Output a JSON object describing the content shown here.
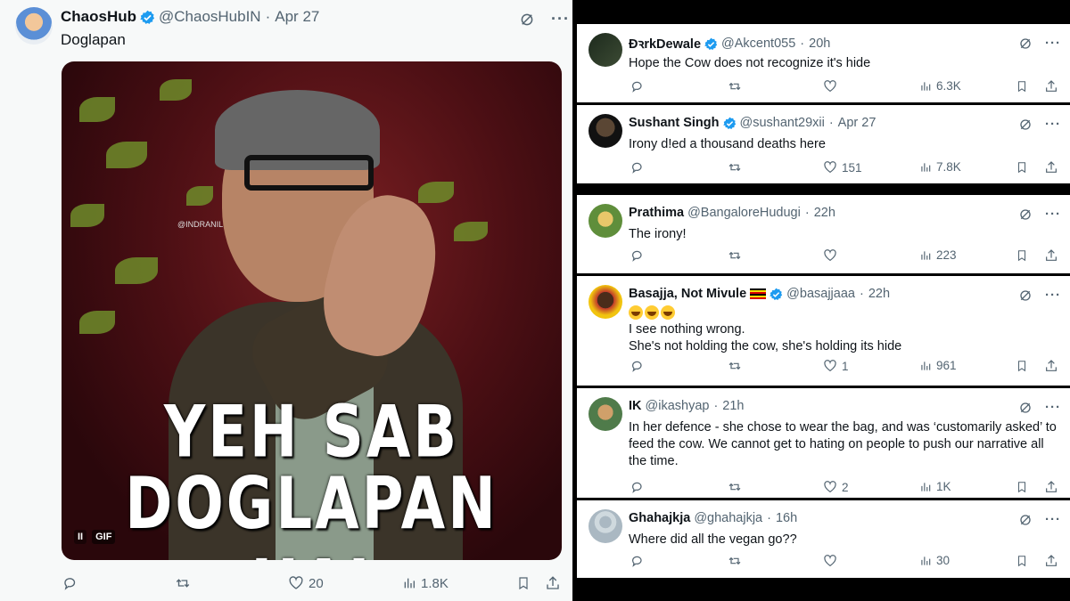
{
  "main_tweet": {
    "name": "ChaosHub",
    "handle": "@ChaosHubIN",
    "date": "Apr 27",
    "text": "Doglapan",
    "media": {
      "caption_line1": "YEH SAB",
      "caption_line2": "DOGLAPAN HAI",
      "watermark": "@INDRANIL",
      "gif_badge": "GIF",
      "pause_glyph": "II"
    },
    "likes": "20",
    "views": "1.8K"
  },
  "replies": [
    {
      "name": "ĐꝛrkDewale",
      "verified": true,
      "handle": "@Akcent055",
      "date": "20h",
      "lines": [
        "Hope the Cow does not recognize it's hide"
      ],
      "likes": "",
      "views": "6.3K"
    },
    {
      "name": "Sushant Singh",
      "verified": true,
      "handle": "@sushant29xii",
      "date": "Apr 27",
      "lines": [
        "Irony d!ed a thousand deaths here"
      ],
      "likes": "151",
      "views": "7.8K"
    },
    {
      "name": "Prathima",
      "verified": false,
      "handle": "@BangaloreHudugi",
      "date": "22h",
      "lines": [
        "The irony!"
      ],
      "likes": "",
      "views": "223"
    },
    {
      "name": "Basajja, Not Mivule",
      "verified": true,
      "handle": "@basajjaaa",
      "date": "22h",
      "lines": [
        "I see nothing wrong.",
        "She's not holding the cow, she's holding its hide"
      ],
      "likes": "1",
      "views": "961"
    },
    {
      "name": "IK",
      "verified": false,
      "handle": "@ikashyap",
      "date": "21h",
      "lines": [
        "In her defence - she chose to wear the bag, and was ‘customarily asked’ to",
        "feed the cow. We cannot get to hating on people to push our narrative all",
        "the time."
      ],
      "likes": "2",
      "views": "1K"
    },
    {
      "name": "Ghahajkja",
      "verified": false,
      "handle": "@ghahajkja",
      "date": "16h",
      "lines": [
        "Where did all the vegan go??"
      ],
      "likes": "",
      "views": "30"
    }
  ],
  "colors": {
    "verified_blue": "#1d9bf0",
    "secondary_text": "#536471",
    "primary_text": "#0f1419"
  },
  "icons": [
    "verified-badge-icon",
    "grok-icon",
    "more-icon",
    "reply-icon",
    "retweet-icon",
    "like-icon",
    "views-icon",
    "bookmark-icon",
    "share-icon"
  ]
}
